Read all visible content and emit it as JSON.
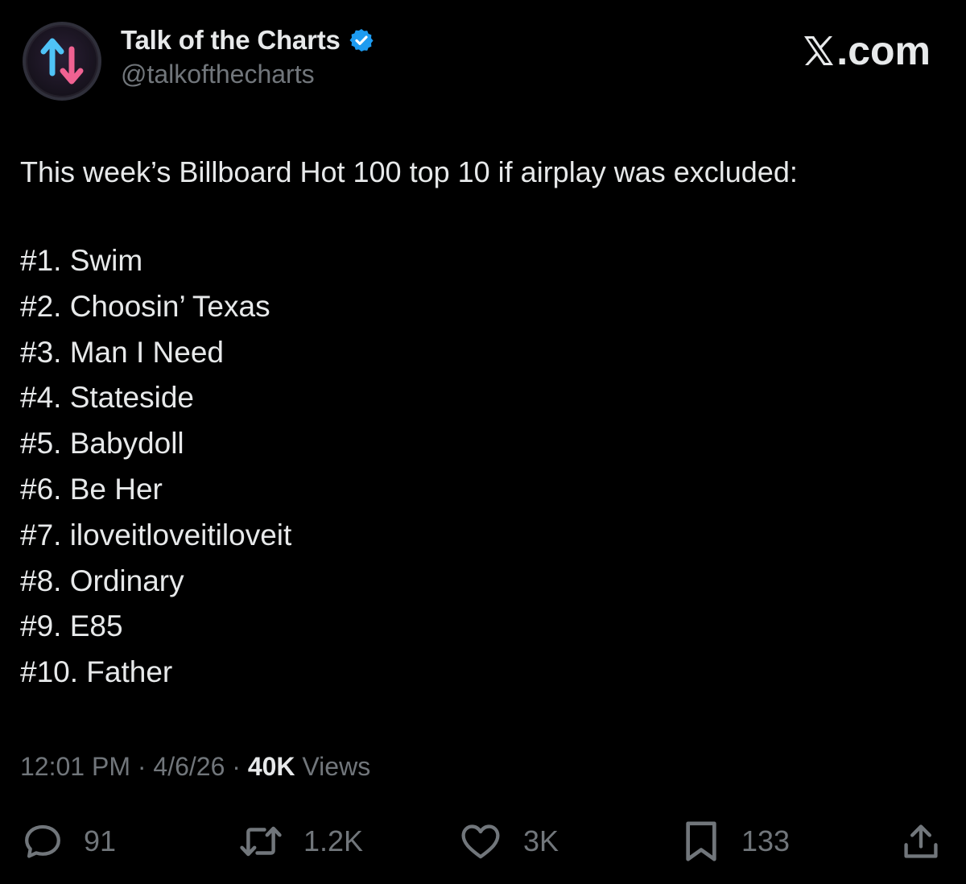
{
  "author": {
    "display_name": "Talk of the Charts",
    "handle": "@talkofthecharts",
    "avatar_icon": "up-down-arrows-icon",
    "verified_icon": "verified-badge-icon",
    "verified_color": "#1d9bf0"
  },
  "brand": {
    "label": ".com",
    "logo_icon": "x-logo-icon"
  },
  "tweet": {
    "intro": "This week’s Billboard Hot 100 top 10 if airplay was excluded:",
    "list": [
      "#1. Swim",
      "#2. Choosin’ Texas",
      "#3. Man I Need",
      "#4. Stateside",
      "#5. Babydoll",
      "#6. Be Her",
      "#7. iloveitloveitiloveit",
      "#8. Ordinary",
      "#9. E85",
      "#10. Father"
    ]
  },
  "meta": {
    "time": "12:01 PM",
    "separator": " · ",
    "date": "4/6/26",
    "views_count": "40K",
    "views_label": " Views"
  },
  "actions": {
    "replies": "91",
    "reposts": "1.2K",
    "likes": "3K",
    "bookmarks": "133"
  },
  "colors": {
    "background": "#000000",
    "text_primary": "#e7e9ea",
    "text_secondary": "#71767b",
    "avatar_up_arrow": "#4fc3f7",
    "avatar_down_arrow": "#f06292"
  }
}
